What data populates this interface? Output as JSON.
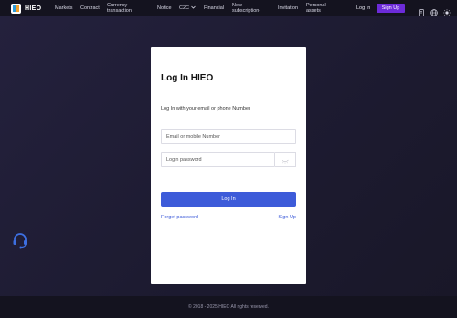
{
  "header": {
    "logo_text": "HIEO",
    "nav": [
      {
        "label": "Markets"
      },
      {
        "label": "Contract"
      },
      {
        "label_line1": "Currency",
        "label_line2": "transaction"
      },
      {
        "label": "Notice"
      },
      {
        "label": "C2C"
      },
      {
        "label": "Financial"
      },
      {
        "label_line1": "New",
        "label_line2": "subscription-"
      },
      {
        "label": "Invitation"
      },
      {
        "label_line1": "Personal",
        "label_line2": "assets"
      }
    ],
    "login_label": "Log In",
    "signup_label": "Sign Up",
    "icons": [
      "download-icon",
      "globe-icon",
      "theme-toggle-icon"
    ]
  },
  "login": {
    "title": "Log In HIEO",
    "subtitle": "Log In with your email or phone Number",
    "email_placeholder": "Email or mobile Number",
    "password_placeholder": "Login password",
    "submit_label": "Log In",
    "forgot_label": "Forget password",
    "signup_label": "Sign Up"
  },
  "footer": {
    "copyright": "© 2018 - 2025 HIEO All rights reserved."
  },
  "colors": {
    "accent_purple": "#6c2bd9",
    "accent_blue": "#3d5bd9",
    "background": "#1d1b31",
    "topbar": "#14131f"
  }
}
